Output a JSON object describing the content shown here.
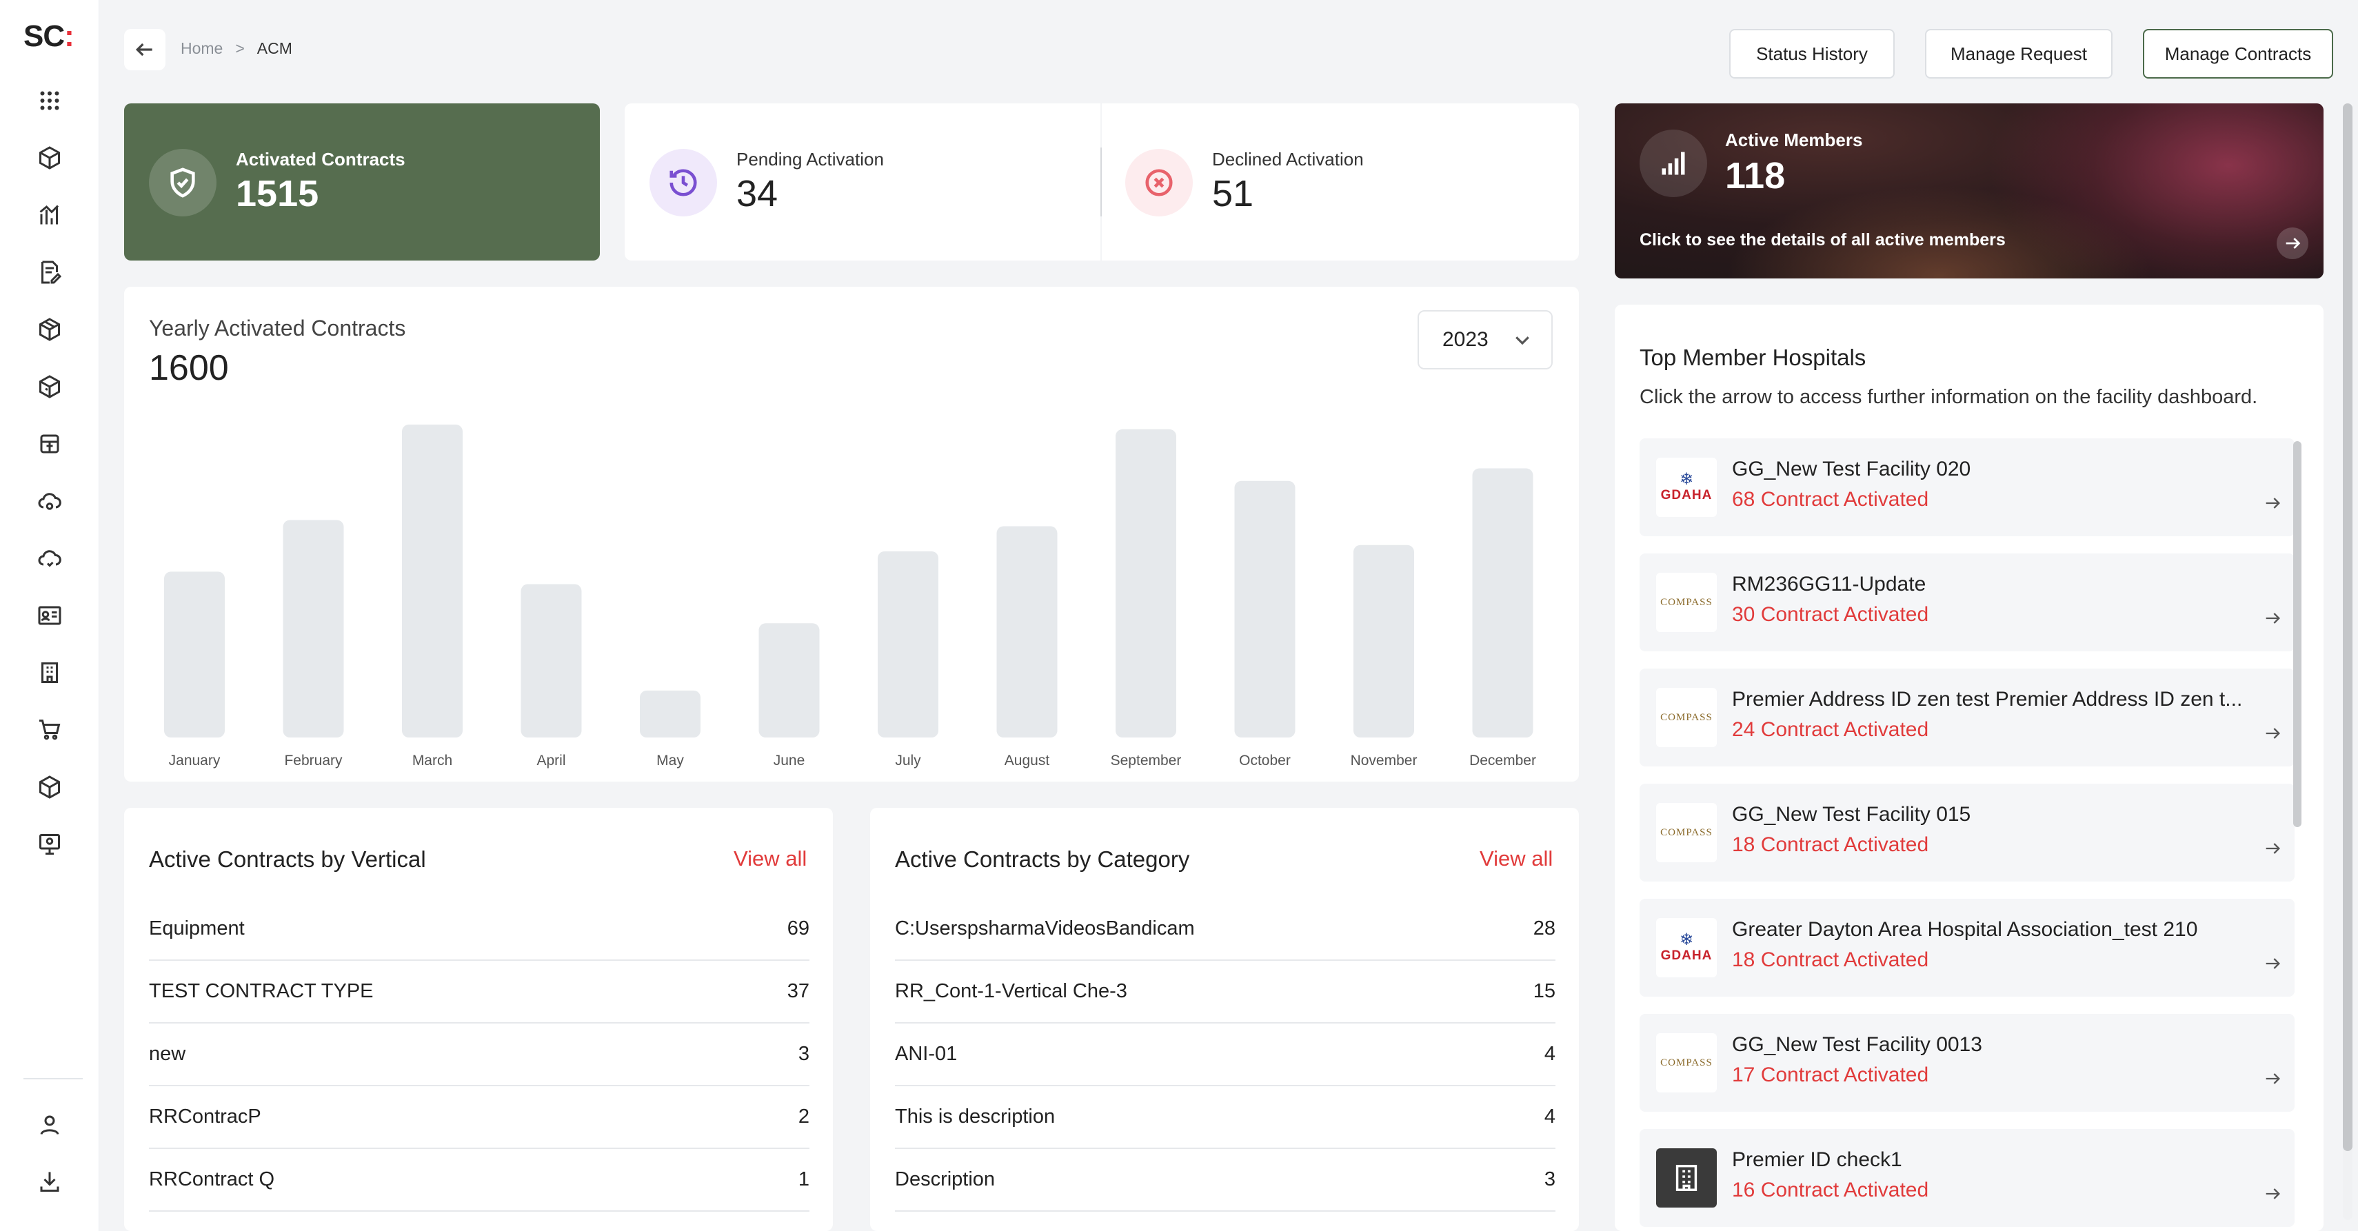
{
  "app": {
    "logo_text": "SC",
    "logo_accent": ":",
    "brand_color": "#e8313b",
    "accent_green": "#566d4f"
  },
  "sidebar": {
    "items": [
      {
        "name": "apps-grid-icon"
      },
      {
        "name": "box-icon"
      },
      {
        "name": "analytics-icon"
      },
      {
        "name": "document-edit-icon"
      },
      {
        "name": "package-icon"
      },
      {
        "name": "package-alt-icon"
      },
      {
        "name": "cube-icon"
      },
      {
        "name": "cloud-settings-icon"
      },
      {
        "name": "cloud-alt-icon"
      },
      {
        "name": "id-card-icon"
      },
      {
        "name": "building-icon"
      },
      {
        "name": "cart-icon"
      },
      {
        "name": "box-outline-icon"
      },
      {
        "name": "monitor-icon"
      }
    ],
    "bottom": [
      {
        "name": "user-icon"
      },
      {
        "name": "download-icon"
      }
    ]
  },
  "breadcrumb": {
    "home": "Home",
    "separator": ">",
    "current": "ACM"
  },
  "toolbar": {
    "status_history": "Status History",
    "manage_request": "Manage Request",
    "manage_contracts": "Manage Contracts"
  },
  "stats": {
    "activated": {
      "label": "Activated Contracts",
      "value": "1515"
    },
    "pending": {
      "label": "Pending Activation",
      "value": "34",
      "color": "#7a4fd1"
    },
    "declined": {
      "label": "Declined Activation",
      "value": "51",
      "color": "#e8626b"
    }
  },
  "active_members": {
    "label": "Active Members",
    "value": "118",
    "cta": "Click to see the details of all active members"
  },
  "yearly": {
    "title": "Yearly Activated Contracts",
    "total": "1600",
    "year": "2023"
  },
  "chart_data": {
    "type": "bar",
    "categories": [
      "January",
      "February",
      "March",
      "April",
      "May",
      "June",
      "July",
      "August",
      "September",
      "October",
      "November",
      "December"
    ],
    "values": [
      106,
      139,
      200,
      98,
      30,
      73,
      119,
      135,
      197,
      164,
      123,
      172
    ],
    "ylim": [
      0,
      200
    ],
    "grid": false,
    "bar_color": "#e6e9ec"
  },
  "vertical_panel": {
    "title": "Active Contracts by Vertical",
    "view_all": "View all",
    "rows": [
      {
        "label": "Equipment",
        "value": "69"
      },
      {
        "label": "TEST CONTRACT TYPE",
        "value": "37"
      },
      {
        "label": "new",
        "value": "3"
      },
      {
        "label": "RRContracP",
        "value": "2"
      },
      {
        "label": "RRContract Q",
        "value": "1"
      }
    ]
  },
  "category_panel": {
    "title": "Active Contracts by Category",
    "view_all": "View all",
    "rows": [
      {
        "label": "C:UserspsharmaVideosBandicam",
        "value": "28"
      },
      {
        "label": "RR_Cont-1-Vertical Che-3",
        "value": "15"
      },
      {
        "label": "ANI-01",
        "value": "4"
      },
      {
        "label": "This is description",
        "value": "4"
      },
      {
        "label": "Description",
        "value": "3"
      }
    ]
  },
  "hospitals": {
    "title": "Top Member Hospitals",
    "subtitle": "Click the arrow to access further information on the facility dashboard.",
    "items": [
      {
        "name": "GG_New Test Facility 020",
        "count": "68 Contract Activated",
        "logo": "gdaha",
        "logo_text": "GDAHA"
      },
      {
        "name": "RM236GG11-Update",
        "count": "30 Contract Activated",
        "logo": "compass",
        "logo_text": "COMPASS"
      },
      {
        "name": "Premier Address ID zen test Premier Address ID zen t...",
        "count": "24 Contract Activated",
        "logo": "compass",
        "logo_text": "COMPASS"
      },
      {
        "name": "GG_New Test Facility 015",
        "count": "18 Contract Activated",
        "logo": "compass",
        "logo_text": "COMPASS"
      },
      {
        "name": "Greater Dayton Area Hospital Association_test 210",
        "count": "18 Contract Activated",
        "logo": "gdaha",
        "logo_text": "GDAHA"
      },
      {
        "name": "GG_New Test Facility 0013",
        "count": "17 Contract Activated",
        "logo": "compass",
        "logo_text": "COMPASS"
      },
      {
        "name": "Premier ID check1",
        "count": "16 Contract Activated",
        "logo": "building",
        "logo_text": ""
      }
    ]
  }
}
